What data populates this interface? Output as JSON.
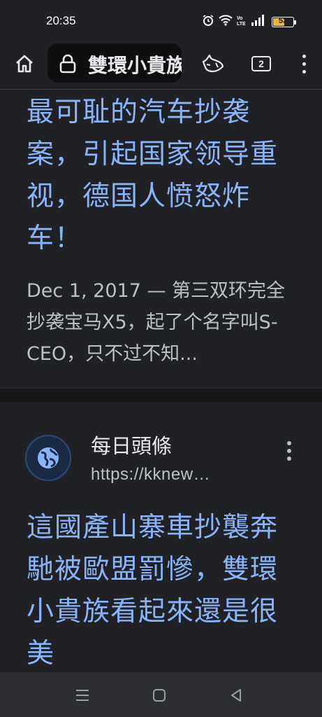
{
  "status_bar": {
    "time": "20:35",
    "icons": [
      "alarm-icon",
      "wifi-icon",
      "volte-icon",
      "signal-icon"
    ],
    "battery_level": "53",
    "battery_fraction": 0.53
  },
  "toolbar": {
    "url_title": "雙環小貴族",
    "tab_count": "2",
    "icons": [
      "home-icon",
      "lock-icon",
      "incognito-icon",
      "tabs-icon",
      "menu-icon"
    ]
  },
  "results": [
    {
      "title": "最可耻的汽车抄袭案，引起国家领导重视，德国人愤怒炸车！",
      "snippet": "Dec 1, 2017 — 第三双环完全抄袭宝马X5，起了个名字叫S-CEO，只不过不知..."
    },
    {
      "source_name": "每日頭條",
      "source_url": "https://kknew…",
      "title": "這國產山寨車抄襲奔馳被歐盟罰慘，雙環小貴族看起來還是很美"
    }
  ],
  "navbar": {
    "icons": [
      "recents-icon",
      "home-nav-icon",
      "back-icon"
    ]
  },
  "colors": {
    "link": "#8ab4f8",
    "background": "#202124",
    "snippet": "#bdc1c6",
    "battery": "#e0b84a"
  }
}
